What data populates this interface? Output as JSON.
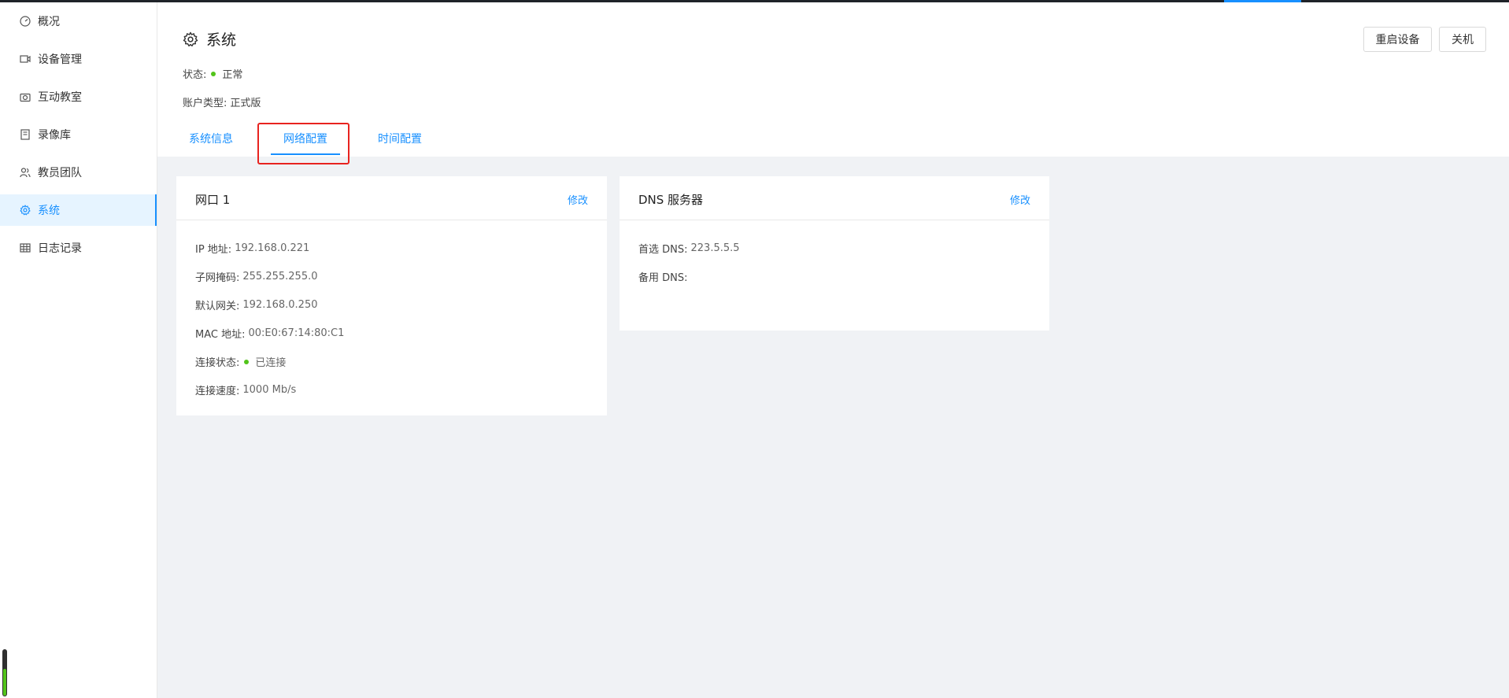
{
  "sidebar": {
    "items": [
      {
        "label": "概况",
        "icon": "dashboard-icon"
      },
      {
        "label": "设备管理",
        "icon": "camera-device-icon"
      },
      {
        "label": "互动教室",
        "icon": "camera-icon"
      },
      {
        "label": "录像库",
        "icon": "book-icon"
      },
      {
        "label": "教员团队",
        "icon": "team-icon"
      },
      {
        "label": "系统",
        "icon": "gear-icon"
      },
      {
        "label": "日志记录",
        "icon": "table-icon"
      }
    ],
    "active_index": 5
  },
  "header": {
    "title": "系统",
    "status_label": "状态:",
    "status_value": "正常",
    "account_label": "账户类型:",
    "account_value": "正式版",
    "restart_label": "重启设备",
    "shutdown_label": "关机"
  },
  "tabs": [
    {
      "label": "系统信息"
    },
    {
      "label": "网络配置"
    },
    {
      "label": "时间配置"
    }
  ],
  "active_tab_index": 1,
  "port_card": {
    "title": "网口 1",
    "edit_label": "修改",
    "ip_label": "IP 地址:",
    "ip_value": "192.168.0.221",
    "mask_label": "子网掩码:",
    "mask_value": "255.255.255.0",
    "gateway_label": "默认网关:",
    "gateway_value": "192.168.0.250",
    "mac_label": "MAC 地址:",
    "mac_value": "00:E0:67:14:80:C1",
    "conn_label": "连接状态:",
    "conn_value": "已连接",
    "speed_label": "连接速度:",
    "speed_value": "1000 Mb/s"
  },
  "dns_card": {
    "title": "DNS 服务器",
    "edit_label": "修改",
    "primary_label": "首选 DNS:",
    "primary_value": "223.5.5.5",
    "secondary_label": "备用 DNS:",
    "secondary_value": ""
  },
  "colors": {
    "accent": "#1890ff",
    "status_green": "#52c41a",
    "highlight_red": "#e8231f"
  }
}
